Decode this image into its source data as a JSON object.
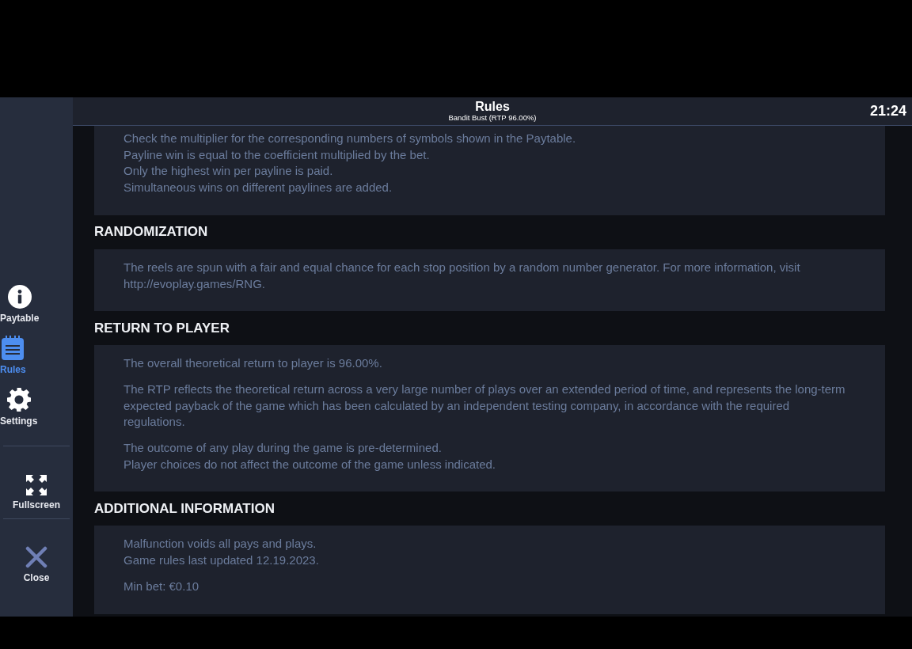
{
  "header": {
    "title": "Rules",
    "subtitle": "Bandit Bust (RTP 96.00%)",
    "clock": "21:24"
  },
  "sidebar": {
    "tabs": [
      {
        "kind": "info",
        "label": "Paytable",
        "selected": false
      },
      {
        "kind": "rules",
        "label": "Rules",
        "selected": true
      },
      {
        "kind": "settings",
        "label": "Settings",
        "selected": false
      }
    ],
    "actions": [
      {
        "kind": "fullscreen",
        "label": "Fullscreen"
      },
      {
        "kind": "close",
        "label": "Close"
      }
    ]
  },
  "sections": [
    {
      "paragraphs": [
        [
          "Check the multiplier for the corresponding numbers of symbols shown in the Paytable.",
          "Payline win is equal to the coefficient multiplied by the bet.",
          "Only the highest win per payline is paid.",
          "Simultaneous wins on different paylines are added."
        ]
      ]
    },
    {
      "heading": "RANDOMIZATION",
      "paragraphs": [
        [
          "The reels are spun with a fair and equal chance for each stop position by a random number generator. For more information, visit http://evoplay.games/RNG."
        ]
      ]
    },
    {
      "heading": "RETURN TO PLAYER",
      "paragraphs": [
        [
          "The overall theoretical return to player is 96.00%."
        ],
        [
          "The RTP reflects the theoretical return across a very large number of plays over an extended period of time, and represents the long-term expected payback of the game which has been calculated by an independent testing company, in accordance with the required regulations."
        ],
        [
          "The outcome of any play during the game is pre-determined.",
          "Player choices do not affect the outcome of the game unless indicated."
        ]
      ]
    },
    {
      "heading": "ADDITIONAL INFORMATION",
      "paragraphs": [
        [
          "Malfunction voids all pays and plays.",
          "Game rules last updated 12.19.2023."
        ],
        [
          "Min bet: €0.10"
        ]
      ]
    }
  ]
}
